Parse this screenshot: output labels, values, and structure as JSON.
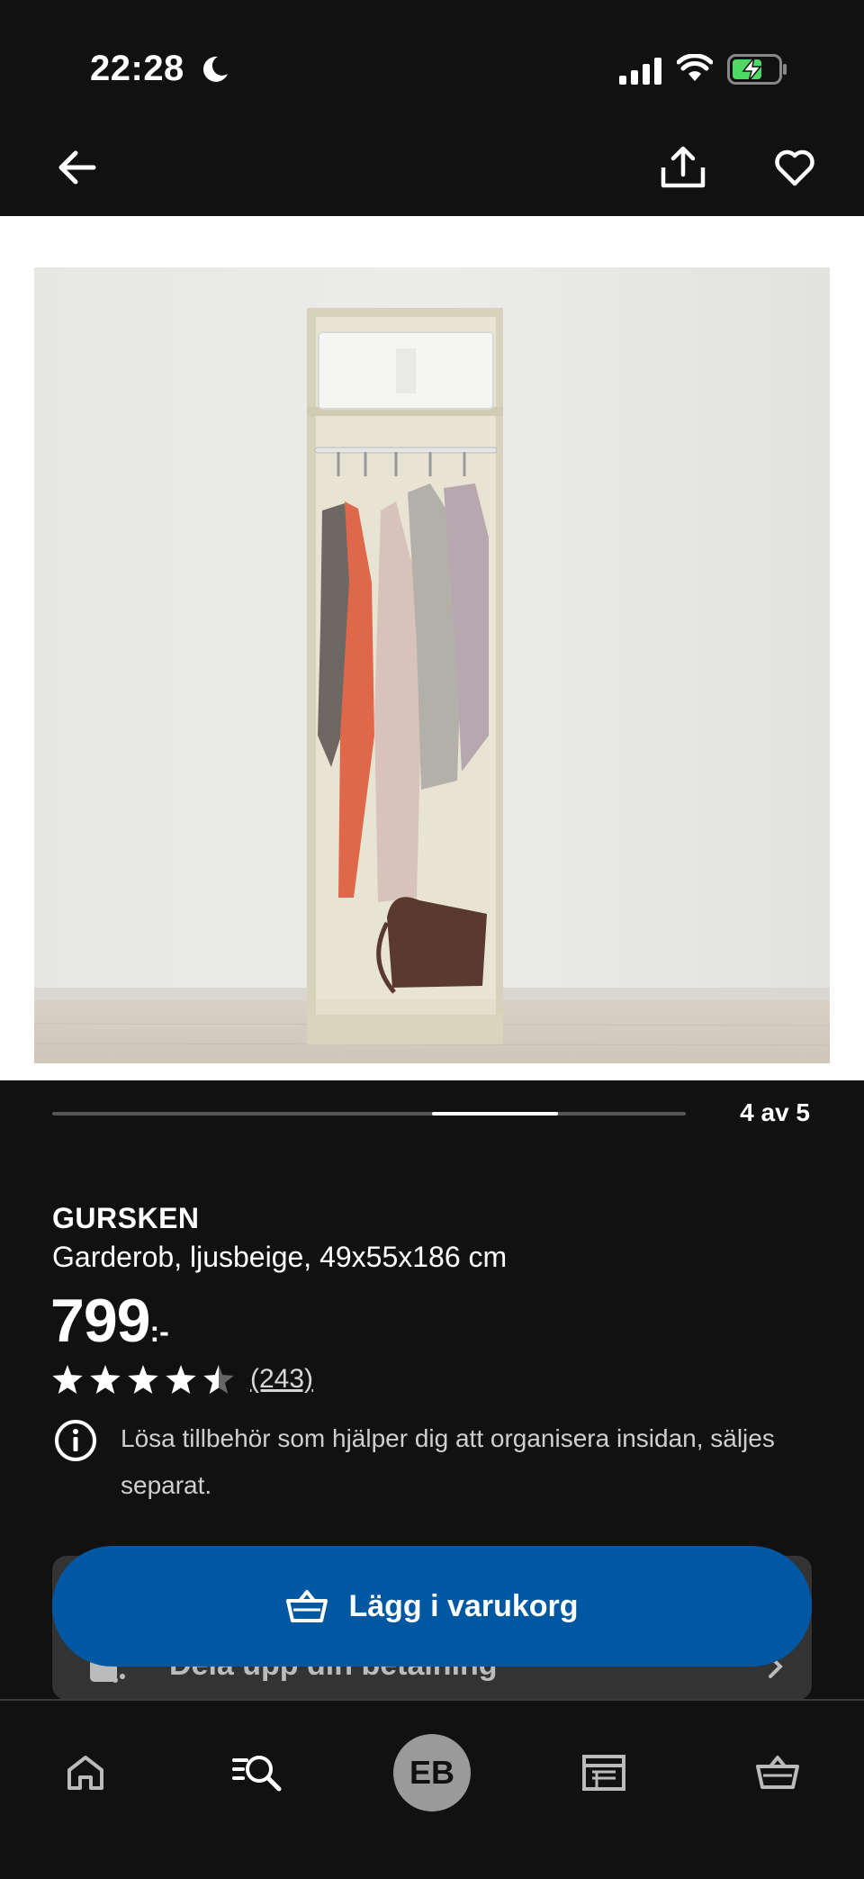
{
  "status_bar": {
    "time": "22:28"
  },
  "nav": {
    "back_icon": "arrow-left-icon",
    "share_icon": "share-icon",
    "favorite_icon": "heart-icon"
  },
  "gallery": {
    "counter": "4 av 5",
    "current_index": 4,
    "total_images": 5
  },
  "product": {
    "name": "GURSKEN",
    "description": "Garderob, ljusbeige, 49x55x186 cm",
    "price": "799",
    "price_suffix": ":-",
    "rating_stars": 4.5,
    "review_count": "(243)",
    "info_text": "Lösa tillbehör som hjälper dig att organisera insidan, säljes separat."
  },
  "partially_hidden_card": {
    "label": "Dela upp din betalning"
  },
  "cart_button": {
    "label": "Lägg i varukorg"
  },
  "bottom_nav": {
    "avatar_initials": "EB"
  },
  "colors": {
    "background": "#111111",
    "primary_blue": "#0058a3",
    "battery_green": "#4cd964"
  }
}
